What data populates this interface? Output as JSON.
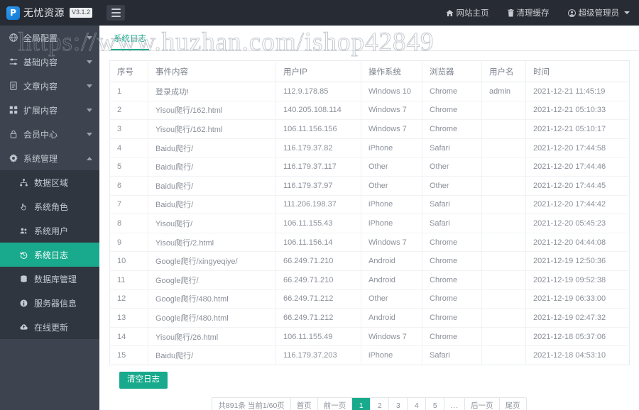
{
  "topbar": {
    "logo_glyph": "P",
    "brand_name": "无忧资源",
    "version_badge": "V3.1.2",
    "menu_toggle_name": "hamburger-menu",
    "nav": [
      {
        "label": "网站主页",
        "icon": "home-icon"
      },
      {
        "label": "清理缓存",
        "icon": "trash-icon"
      },
      {
        "label": "超级管理员",
        "icon": "user-circle-icon",
        "has_caret": true
      }
    ]
  },
  "sidebar": {
    "items": [
      {
        "label": "全局配置",
        "icon": "globe-icon",
        "arrow": "down",
        "expanded": false
      },
      {
        "label": "基础内容",
        "icon": "sliders-icon",
        "arrow": "down",
        "expanded": false
      },
      {
        "label": "文章内容",
        "icon": "file-text-icon",
        "arrow": "down",
        "expanded": false
      },
      {
        "label": "扩展内容",
        "icon": "puzzle-icon",
        "arrow": "down",
        "expanded": false
      },
      {
        "label": "会员中心",
        "icon": "lock-icon",
        "arrow": "down",
        "expanded": false
      },
      {
        "label": "系统管理",
        "icon": "gear-icon",
        "arrow": "up",
        "expanded": true
      }
    ],
    "submenu": [
      {
        "label": "数据区域",
        "icon": "sitemap-icon",
        "active": false
      },
      {
        "label": "系统角色",
        "icon": "hand-icon",
        "active": false
      },
      {
        "label": "系统用户",
        "icon": "users-icon",
        "active": false
      },
      {
        "label": "系统日志",
        "icon": "history-icon",
        "active": true
      },
      {
        "label": "数据库管理",
        "icon": "database-icon",
        "active": false
      },
      {
        "label": "服务器信息",
        "icon": "info-circle-icon",
        "active": false
      },
      {
        "label": "在线更新",
        "icon": "cloud-upload-icon",
        "active": false
      }
    ]
  },
  "tabs": [
    {
      "label": "系统日志",
      "active": true
    }
  ],
  "table": {
    "columns": [
      "序号",
      "事件内容",
      "用户IP",
      "操作系统",
      "浏览器",
      "用户名",
      "时间"
    ],
    "rows": [
      [
        "1",
        "登录成功!",
        "112.9.178.85",
        "Windows 10",
        "Chrome",
        "admin",
        "2021-12-21 11:45:19"
      ],
      [
        "2",
        "Yisou爬行/162.html",
        "140.205.108.114",
        "Windows 7",
        "Chrome",
        "",
        "2021-12-21 05:10:33"
      ],
      [
        "3",
        "Yisou爬行/162.html",
        "106.11.156.156",
        "Windows 7",
        "Chrome",
        "",
        "2021-12-21 05:10:17"
      ],
      [
        "4",
        "Baidu爬行/",
        "116.179.37.82",
        "iPhone",
        "Safari",
        "",
        "2021-12-20 17:44:58"
      ],
      [
        "5",
        "Baidu爬行/",
        "116.179.37.117",
        "Other",
        "Other",
        "",
        "2021-12-20 17:44:46"
      ],
      [
        "6",
        "Baidu爬行/",
        "116.179.37.97",
        "Other",
        "Other",
        "",
        "2021-12-20 17:44:45"
      ],
      [
        "7",
        "Baidu爬行/",
        "111.206.198.37",
        "iPhone",
        "Safari",
        "",
        "2021-12-20 17:44:42"
      ],
      [
        "8",
        "Yisou爬行/",
        "106.11.155.43",
        "iPhone",
        "Safari",
        "",
        "2021-12-20 05:45:23"
      ],
      [
        "9",
        "Yisou爬行/2.html",
        "106.11.156.14",
        "Windows 7",
        "Chrome",
        "",
        "2021-12-20 04:44:08"
      ],
      [
        "10",
        "Google爬行/xingyeqiye/",
        "66.249.71.210",
        "Android",
        "Chrome",
        "",
        "2021-12-19 12:50:36"
      ],
      [
        "11",
        "Google爬行/",
        "66.249.71.210",
        "Android",
        "Chrome",
        "",
        "2021-12-19 09:52:38"
      ],
      [
        "12",
        "Google爬行/480.html",
        "66.249.71.212",
        "Other",
        "Chrome",
        "",
        "2021-12-19 06:33:00"
      ],
      [
        "13",
        "Google爬行/480.html",
        "66.249.71.212",
        "Android",
        "Chrome",
        "",
        "2021-12-19 02:47:32"
      ],
      [
        "14",
        "Yisou爬行/26.html",
        "106.11.155.49",
        "Windows 7",
        "Chrome",
        "",
        "2021-12-18 05:37:06"
      ],
      [
        "15",
        "Baidu爬行/",
        "116.179.37.203",
        "iPhone",
        "Safari",
        "",
        "2021-12-18 04:53:10"
      ]
    ]
  },
  "actions": {
    "clear_log_label": "清空日志"
  },
  "pagination": {
    "summary": "共891条 当前1/60页",
    "first_label": "首页",
    "prev_label": "前一页",
    "pages": [
      "1",
      "2",
      "3",
      "4",
      "5"
    ],
    "ellipsis": "...",
    "next_label": "后一页",
    "last_label": "尾页",
    "active_page": "1"
  },
  "watermark": {
    "text": "https://www.huzhan.com/ishop42849"
  },
  "colors": {
    "accent": "#19aa8d",
    "sidebar_bg": "#3d4450",
    "submenu_bg": "#2f3640",
    "topbar_bg": "#272b33"
  }
}
